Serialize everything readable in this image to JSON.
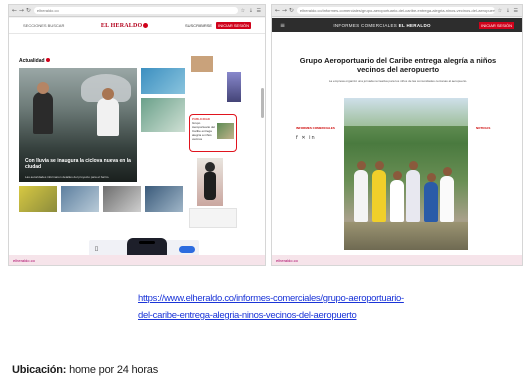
{
  "left_panel": {
    "browser": {
      "nav_icons": "← → ↻",
      "url": "elheraldo.co",
      "tools": "☆ ↓ ☰"
    },
    "site": {
      "header_left": "SECCIONES  BUSCAR",
      "logo": "EL HERALDO",
      "header_right_text": "SUSCRIBIRSE",
      "header_right_button": "INICIAR SESIÓN"
    },
    "section_tag": "Actualidad",
    "hero": {
      "headline": "Con lluvia se inaugura la ciclova nueva en la ciudad",
      "sub": "Las autoridades informaron detalles del proyecto para el barrio."
    },
    "highlight": {
      "tag": "PUBLICIDAD",
      "text": "Grupo Aeroportuario del Caribe entrega alegría a niños vecinos"
    },
    "status": "elheraldo.co"
  },
  "right_panel": {
    "browser": {
      "nav_icons": "← → ↻",
      "url": "elheraldo.co/informes-comerciales/grupo-aeroportuario-del-caribe-entrega-alegria-ninos-vecinos-del-aeropuerto",
      "tools": "☆ ↓ ☰"
    },
    "site": {
      "burger": "≡",
      "brand_prefix": "INFORMES COMERCIALES",
      "brand": "EL HERALDO",
      "header_right_button": "INICIAR SESIÓN"
    },
    "article": {
      "title": "Grupo Aeroportuario del Caribe entrega alegría a niños vecinos del aeropuerto",
      "sub": "La empresa organizó una jornada recreativa para los niños de las comunidades cercanas al aeropuerto."
    },
    "left_col": {
      "label": "INFORMES COMERCIALES",
      "social": "f ✕ in"
    },
    "right_col": {
      "label": "NOTICIAS"
    },
    "status": "elheraldo.co"
  },
  "caption": {
    "link_line1": "https://www.elheraldo.co/informes-comerciales/grupo-aeroportuario-",
    "link_line2": "del-caribe-entrega-alegria-ninos-vecinos-del-aeropuerto",
    "location_label": "Ubicación:",
    "location_value": " home por 24 horas"
  }
}
